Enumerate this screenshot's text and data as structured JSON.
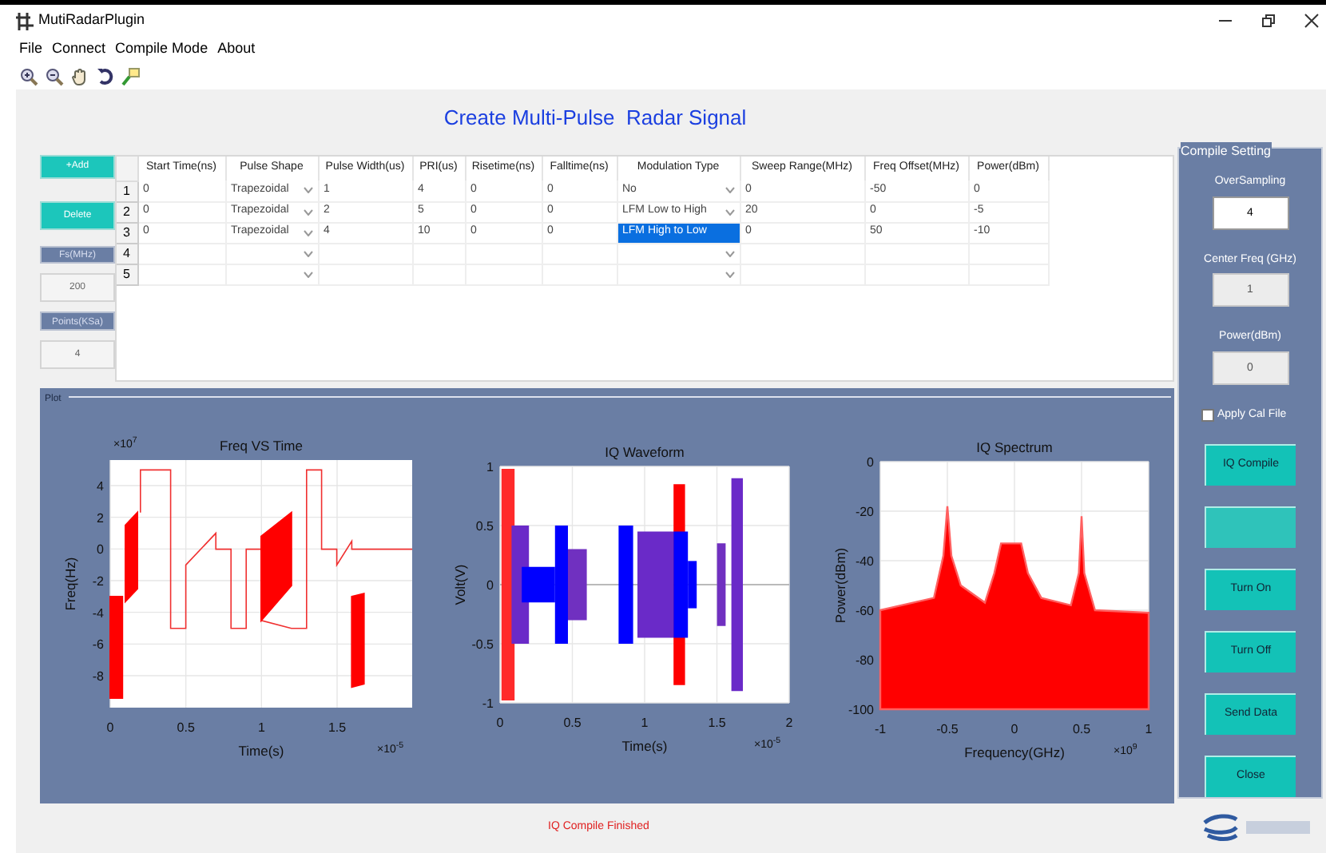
{
  "window": {
    "title": "MutiRadarPlugin"
  },
  "menu": [
    "File",
    "Connect",
    "Compile Mode",
    "About"
  ],
  "heading": "Create Multi-Pulse  Radar Signal",
  "left_controls": {
    "add_button": "+Add",
    "delete_button": "Delete",
    "fs_label": "Fs(MHz)",
    "fs_value": "200",
    "points_label": "Points(KSa)",
    "points_value": "4"
  },
  "table": {
    "columns": [
      {
        "label": "Start Time(ns)",
        "kind": "text"
      },
      {
        "label": "Pulse Shape",
        "kind": "dropdown"
      },
      {
        "label": "Pulse Width(us)",
        "kind": "text"
      },
      {
        "label": "PRI(us)",
        "kind": "text"
      },
      {
        "label": "Risetime(ns)",
        "kind": "text"
      },
      {
        "label": "Falltime(ns)",
        "kind": "text"
      },
      {
        "label": "Modulation Type",
        "kind": "dropdown"
      },
      {
        "label": "Sweep Range(MHz)",
        "kind": "text"
      },
      {
        "label": "Freq Offset(MHz)",
        "kind": "text"
      },
      {
        "label": "Power(dBm)",
        "kind": "text"
      }
    ],
    "rows": [
      {
        "number": "1",
        "cells": [
          {
            "text": "0",
            "selected": false
          },
          {
            "text": "Trapezoidal",
            "selected": false
          },
          {
            "text": "1",
            "selected": false
          },
          {
            "text": "4",
            "selected": false
          },
          {
            "text": "0",
            "selected": false
          },
          {
            "text": "0",
            "selected": false
          },
          {
            "text": "No",
            "selected": false
          },
          {
            "text": "0",
            "selected": false
          },
          {
            "text": "-50",
            "selected": false
          },
          {
            "text": "0",
            "selected": false
          }
        ]
      },
      {
        "number": "2",
        "cells": [
          {
            "text": "0",
            "selected": false
          },
          {
            "text": "Trapezoidal",
            "selected": false
          },
          {
            "text": "2",
            "selected": false
          },
          {
            "text": "5",
            "selected": false
          },
          {
            "text": "0",
            "selected": false
          },
          {
            "text": "0",
            "selected": false
          },
          {
            "text": "LFM Low to High",
            "selected": false
          },
          {
            "text": "20",
            "selected": false
          },
          {
            "text": "0",
            "selected": false
          },
          {
            "text": "-5",
            "selected": false
          }
        ]
      },
      {
        "number": "3",
        "cells": [
          {
            "text": "0",
            "selected": false
          },
          {
            "text": "Trapezoidal",
            "selected": false
          },
          {
            "text": "4",
            "selected": false
          },
          {
            "text": "10",
            "selected": false
          },
          {
            "text": "0",
            "selected": false
          },
          {
            "text": "0",
            "selected": false
          },
          {
            "text": "LFM High to Low",
            "selected": true
          },
          {
            "text": "0",
            "selected": false
          },
          {
            "text": "50",
            "selected": false
          },
          {
            "text": "-10",
            "selected": false
          }
        ]
      },
      {
        "number": "4"
      },
      {
        "number": "5"
      }
    ]
  },
  "plot_panel": {
    "title": "Plot",
    "plots": [
      {
        "kind": "freq",
        "title": "Freq VS Time",
        "ylabel": "Freq(Hz)",
        "xlabel": "Time(s)",
        "y_exponent": "×10$^{7}$",
        "x_exponent": "×10$^{-5}$",
        "yticks": [
          "4",
          "2",
          "0",
          "-2",
          "-4",
          "-6",
          "-8"
        ],
        "xticks": [
          "0",
          "0.5",
          "1",
          "1.5"
        ]
      },
      {
        "kind": "iq",
        "title": "IQ Waveform",
        "ylabel": "Volt(V)",
        "xlabel": "Time(s)",
        "x_exponent": "×10$^{-5}$",
        "yticks": [
          "1",
          "0.5",
          "0",
          "-0.5",
          "-1"
        ],
        "xticks": [
          "0",
          "0.5",
          "1",
          "1.5",
          "2"
        ]
      },
      {
        "kind": "spectrum",
        "title": "IQ Spectrum",
        "ylabel": "Power(dBm)",
        "xlabel": "Frequency(GHz)",
        "x_exponent": "×10$^{9}$",
        "yticks": [
          "0",
          "-20",
          "-40",
          "-60",
          "-80",
          "-100"
        ],
        "xticks": [
          "-1",
          "-0.5",
          "0",
          "0.5",
          "1"
        ]
      }
    ]
  },
  "compile_setting": {
    "title": "Compile Setting",
    "fields": [
      {
        "label": "OverSampling",
        "value": "4",
        "disabled": false
      },
      {
        "label": "Center Freq (GHz)",
        "value": "1",
        "disabled": true
      },
      {
        "label": "Power(dBm)",
        "value": "0",
        "disabled": true
      }
    ],
    "apply_cal_file": {
      "label": "Apply Cal File",
      "checked": false
    },
    "buttons": [
      {
        "label": "IQ Compile",
        "disabled": false
      },
      {
        "disabled": true
      },
      {
        "label": "Turn On",
        "disabled": false
      },
      {
        "label": "Turn Off",
        "disabled": false
      },
      {
        "label": "Send Data",
        "disabled": false
      },
      {
        "label": "Close",
        "disabled": false
      }
    ]
  },
  "status": "IQ Compile Finished"
}
